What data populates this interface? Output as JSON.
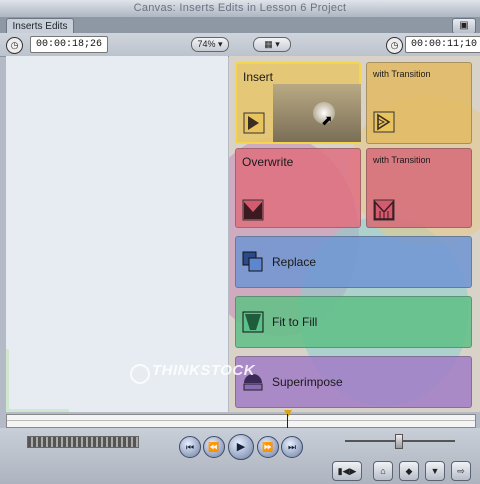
{
  "window": {
    "title": "Canvas: Inserts Edits in Lesson 6 Project"
  },
  "tabs": [
    {
      "label": "Inserts Edits"
    }
  ],
  "controls": {
    "left_timecode": "00:00:18;26",
    "zoom": "74%",
    "view_icon": "view-options-icon",
    "right_timecode": "00:00:11;10"
  },
  "watermark": "THINKSTOCK",
  "edit_overlay": {
    "insert": {
      "label": "Insert"
    },
    "insert_with_transition": {
      "label": "with Transition"
    },
    "overwrite": {
      "label": "Overwrite"
    },
    "overwrite_with_transition": {
      "label": "with Transition"
    },
    "replace": {
      "label": "Replace"
    },
    "fit_to_fill": {
      "label": "Fit to Fill"
    },
    "superimpose": {
      "label": "Superimpose"
    }
  },
  "colors": {
    "insert": "#e8c66a",
    "overwrite": "#df6f80",
    "replace": "#6f95d4",
    "fit_to_fill": "#5fbf86",
    "superimpose": "#a27cc7",
    "selected_border": "#f3d64a"
  },
  "transport": {
    "buttons": [
      "go-to-start",
      "previous-edit",
      "play",
      "next-edit",
      "go-to-end"
    ],
    "icons": [
      "match-frame-icon",
      "mark-clip-icon",
      "add-keyframe-icon",
      "add-marker-icon",
      "mark-in-out-icon"
    ]
  }
}
